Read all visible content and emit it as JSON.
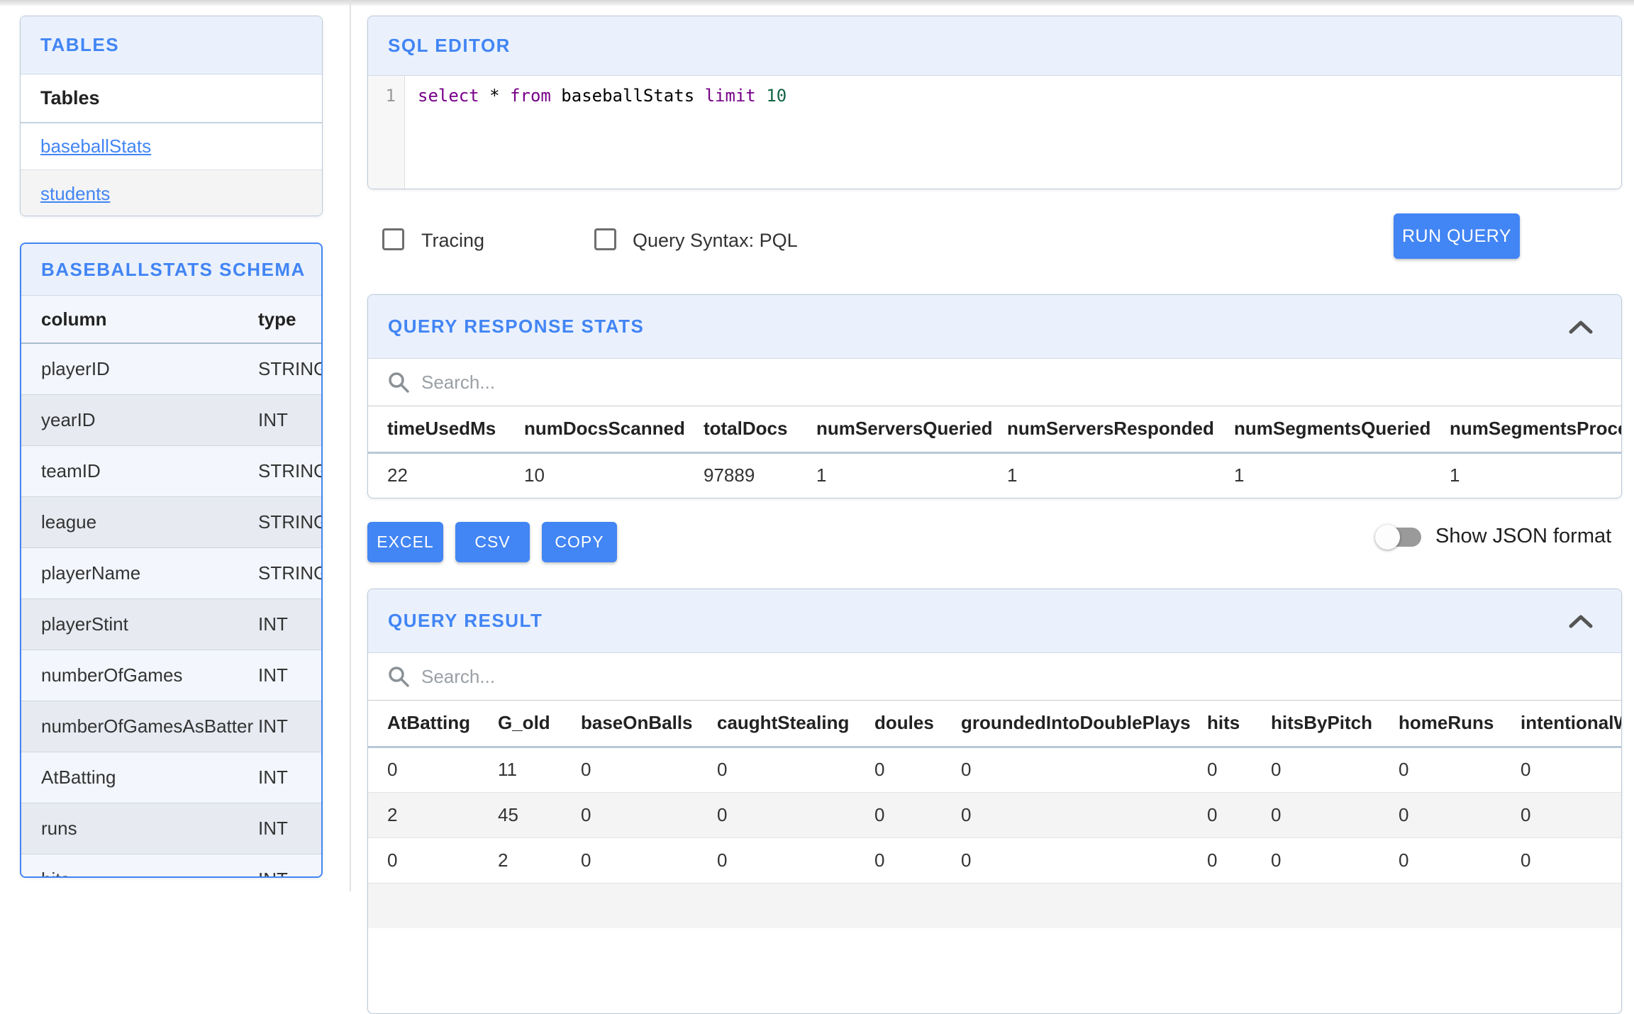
{
  "colors": {
    "accent": "#4285f4",
    "panel_header_bg": "#eaf1fd",
    "selected_panel_border": "#4285f4",
    "code_keyword": "#770088",
    "code_number": "#116644"
  },
  "icons": {
    "search": "magnifier",
    "collapse": "chevron-up"
  },
  "sidebar": {
    "tables_panel": {
      "title": "TABLES",
      "header": "Tables",
      "items": [
        {
          "label": "baseballStats"
        },
        {
          "label": "students"
        }
      ]
    },
    "schema_panel": {
      "title": "BASEBALLSTATS SCHEMA",
      "col_header": "column",
      "type_header": "type",
      "rows": [
        {
          "column": "playerID",
          "type": "STRING"
        },
        {
          "column": "yearID",
          "type": "INT"
        },
        {
          "column": "teamID",
          "type": "STRING"
        },
        {
          "column": "league",
          "type": "STRING"
        },
        {
          "column": "playerName",
          "type": "STRING"
        },
        {
          "column": "playerStint",
          "type": "INT"
        },
        {
          "column": "numberOfGames",
          "type": "INT"
        },
        {
          "column": "numberOfGamesAsBatter",
          "type": "INT"
        },
        {
          "column": "AtBatting",
          "type": "INT"
        },
        {
          "column": "runs",
          "type": "INT"
        },
        {
          "column": "hits",
          "type": "INT"
        }
      ]
    }
  },
  "editor": {
    "title": "SQL EDITOR",
    "line_number": "1",
    "code_tokens": [
      {
        "text": "select",
        "type": "keyword"
      },
      {
        "text": " * ",
        "type": "plain"
      },
      {
        "text": "from",
        "type": "keyword"
      },
      {
        "text": " baseballStats ",
        "type": "plain"
      },
      {
        "text": "limit",
        "type": "keyword"
      },
      {
        "text": " ",
        "type": "plain"
      },
      {
        "text": "10",
        "type": "number"
      }
    ]
  },
  "controls": {
    "tracing_label": "Tracing",
    "pql_label": "Query Syntax: PQL",
    "run_button": "RUN QUERY"
  },
  "response_stats": {
    "title": "QUERY RESPONSE STATS",
    "search_placeholder": "Search...",
    "columns": [
      "timeUsedMs",
      "numDocsScanned",
      "totalDocs",
      "numServersQueried",
      "numServersResponded",
      "numSegmentsQueried",
      "numSegmentsProcessed"
    ],
    "rows": [
      [
        "22",
        "10",
        "97889",
        "1",
        "1",
        "1",
        "1"
      ]
    ]
  },
  "export": {
    "excel": "EXCEL",
    "csv": "CSV",
    "copy": "COPY",
    "json_toggle_label": "Show JSON format"
  },
  "query_result": {
    "title": "QUERY RESULT",
    "search_placeholder": "Search...",
    "columns": [
      "AtBatting",
      "G_old",
      "baseOnBalls",
      "caughtStealing",
      "doules",
      "groundedIntoDoublePlays",
      "hits",
      "hitsByPitch",
      "homeRuns",
      "intentionalWalks"
    ],
    "rows": [
      [
        "0",
        "11",
        "0",
        "0",
        "0",
        "0",
        "0",
        "0",
        "0",
        "0"
      ],
      [
        "2",
        "45",
        "0",
        "0",
        "0",
        "0",
        "0",
        "0",
        "0",
        "0"
      ],
      [
        "0",
        "2",
        "0",
        "0",
        "0",
        "0",
        "0",
        "0",
        "0",
        "0"
      ]
    ]
  }
}
